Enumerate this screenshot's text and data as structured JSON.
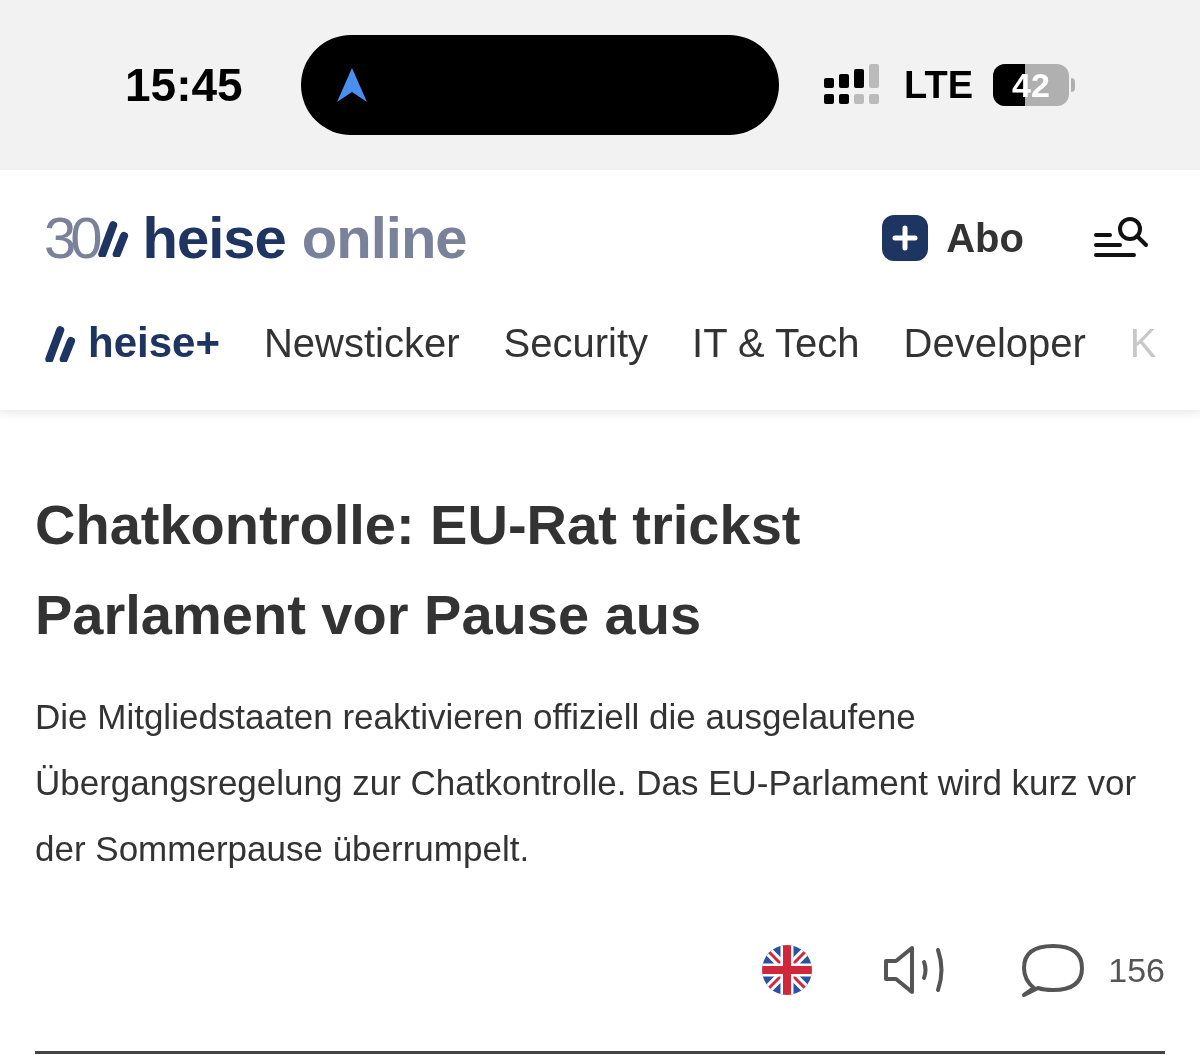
{
  "status_bar": {
    "time": "15:45",
    "network": "LTE",
    "battery": {
      "text": "42",
      "level": 0.42
    }
  },
  "header": {
    "logo": {
      "anniversary": "30",
      "brand": "heise",
      "suffix": "online"
    },
    "subscribe": "Abo"
  },
  "nav": {
    "items": [
      {
        "kind": "brand",
        "label": "heise+"
      },
      {
        "kind": "link",
        "label": "Newsticker"
      },
      {
        "kind": "link",
        "label": "Security"
      },
      {
        "kind": "link",
        "label": "IT & Tech"
      },
      {
        "kind": "link",
        "label": "Developer"
      },
      {
        "kind": "cut",
        "label": "K"
      }
    ]
  },
  "article": {
    "title": "Chatkontrolle: EU-Rat trickst Parlament vor Pause aus",
    "lead": "Die Mitgliedstaaten reaktivieren offiziell die ausgelaufene Übergangsregelung zur Chatkontrolle. Das EU-Parlament wird kurz vor der Sommerpause überrumpelt.",
    "comments": "156"
  }
}
